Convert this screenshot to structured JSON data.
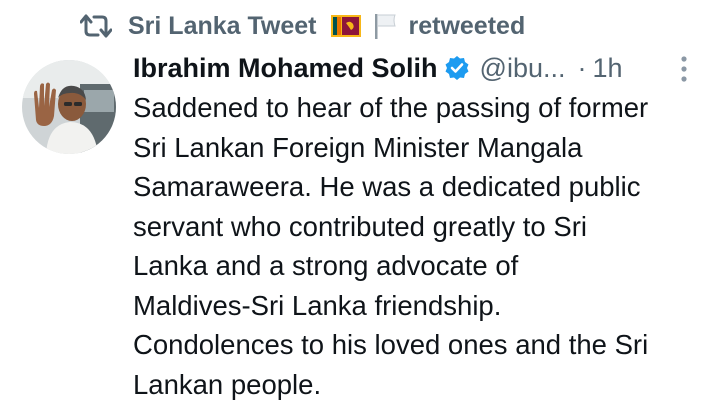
{
  "retweet": {
    "icon": "retweet-icon",
    "retweeter_name": "Sri Lanka Tweet",
    "flag_1": "sri-lanka-flag-icon",
    "flag_2": "white-flag-icon",
    "label": "retweeted"
  },
  "author": {
    "avatar": "avatar",
    "name": "Ibrahim Mohamed Solih",
    "verified_icon": "verified-badge-icon",
    "handle": "@ibu...",
    "separator": "·",
    "time": "1h"
  },
  "menu": {
    "icon": "more-options-icon"
  },
  "tweet": {
    "lines": [
      "Saddened to hear of the passing of former",
      "Sri Lankan Foreign Minister Mangala",
      "Samaraweera. He was a dedicated public",
      "servant who contributed greatly to Sri",
      "Lanka and a strong advocate of",
      "Maldives-Sri Lanka friendship.",
      "Condolences to his loved ones and the Sri",
      "Lankan people."
    ]
  },
  "colors": {
    "text": "#0f1419",
    "muted": "#536471",
    "verified": "#1d9bf0"
  }
}
